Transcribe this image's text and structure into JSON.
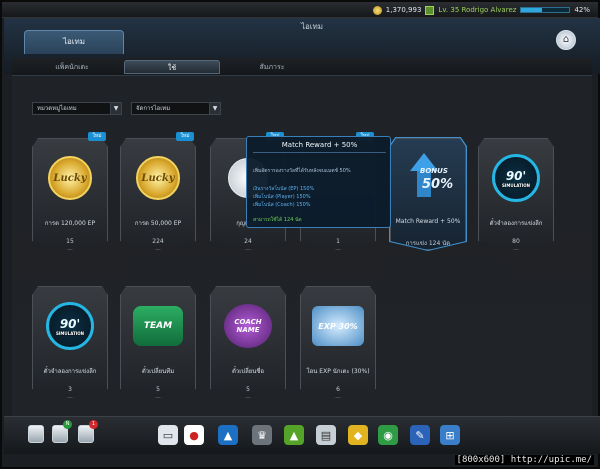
{
  "window": {
    "title": "ไอเทม"
  },
  "status": {
    "money": "1,370,993",
    "level": "Lv. 35 Rodrigo Alvarez",
    "xp_percent": "42%",
    "xp_fraction": 0.42
  },
  "header": {
    "main_tab": "ไอเทม"
  },
  "subtabs": [
    {
      "label": "แพ็คนักเตะ"
    },
    {
      "label": "ใช้"
    },
    {
      "label": "สัมภาระ"
    }
  ],
  "filters": {
    "category": "หมวดหมู่ไอเทม",
    "sort": "จัดการไอเทม"
  },
  "new_badge": "ใหม่",
  "cards": [
    {
      "label": "การด 120,000 EP",
      "count": "15",
      "art_text": "Lucky"
    },
    {
      "label": "การด 50,000 EP",
      "count": "224",
      "art_text": "Lucky"
    },
    {
      "label": "กุญแจลีก",
      "count": "24",
      "art_text": "'08"
    },
    {
      "label": "",
      "count": "1",
      "art_text": ""
    },
    {
      "label": "Match Reward + 50%",
      "count": "การแข่ง 124 นัด",
      "art_text_top": "BONUS",
      "art_text_bottom": "50%"
    },
    {
      "label": "ตั๋วจำลองการแข่งลีก",
      "count": "80",
      "art_text_big": "90'",
      "art_text_small": "SIMULATION"
    },
    {
      "label": "ตั๋วจำลองการแข่งลีก",
      "count": "3",
      "art_text_big": "90'",
      "art_text_small": "SIMULATION"
    },
    {
      "label": "ตั๋วเปลี่ยนทีม",
      "count": "5",
      "art_text": "TEAM"
    },
    {
      "label": "ตั๋วเปลี่ยนชื่อ",
      "count": "5",
      "art_text": "COACH NAME"
    },
    {
      "label": "โอน EXP นักเตะ (30%)",
      "count": "6",
      "art_text": "EXP 30%"
    }
  ],
  "tooltip": {
    "title": "Match Reward + 50%",
    "desc": "เพิ่มอัตรารองรางวัลที่ได้รับหลังจบแมตช์ 50%",
    "lines": [
      "เงินรางวัลโบนัส (EP) 150%",
      "เพิ่มโบนัส (Player) 150%",
      "เพิ่มโบนัส (Coach) 150%"
    ],
    "available": "สามารถใช้ได้ 124 นัด"
  },
  "bottom": {
    "badge_n": "N",
    "badge_1": "1"
  },
  "watermark": "[800x600] http://upic.me/",
  "colors": {
    "accent": "#3f8fca",
    "new_badge": "#1a8fd1",
    "green_text": "#6fd05a"
  }
}
